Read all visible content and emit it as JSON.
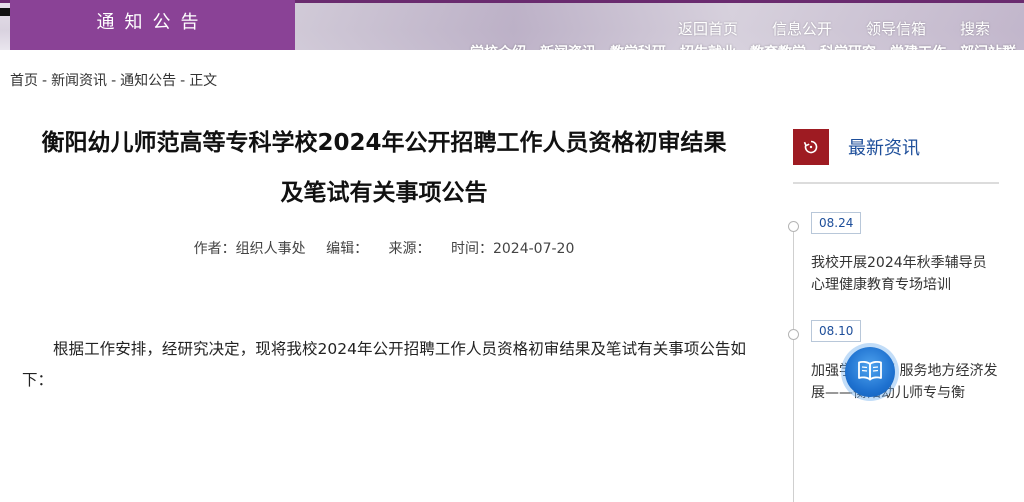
{
  "banner": {
    "section_tag": "通知公告",
    "top_nav": [
      "返回首页",
      "信息公开",
      "领导信箱",
      "搜索"
    ],
    "sub_nav": [
      "学校介绍",
      "新闻资讯",
      "教学科研",
      "招生就业",
      "教育教学",
      "科学研究",
      "党建工作",
      "部门站群"
    ]
  },
  "breadcrumb": [
    "首页",
    "新闻资讯",
    "通知公告",
    "正文"
  ],
  "article": {
    "title_line1": "衡阳幼儿师范高等专科学校2024年公开招聘工作人员资格初审结果",
    "title_line2": "及笔试有关事项公告",
    "author_label": "作者：组织人事处",
    "editor_label": "编辑：",
    "source_label": "来源：",
    "time_label": "时间：2024-07-20",
    "body": "根据工作安排，经研究决定，现将我校2024年公开招聘工作人员资格初审结果及笔试有关事项公告如下："
  },
  "sidebar": {
    "title": "最新资讯",
    "news": [
      {
        "date": "08.24",
        "title": "我校开展2024年秋季辅导员心理健康教育专场培训"
      },
      {
        "date": "08.10",
        "title": "加强学科调研 服务地方经济发展——衡阳幼儿师专与衡"
      }
    ]
  },
  "colors": {
    "brand_purple": "#8a4296",
    "accent_red": "#9e1b22",
    "link_blue": "#1d4e9a"
  }
}
